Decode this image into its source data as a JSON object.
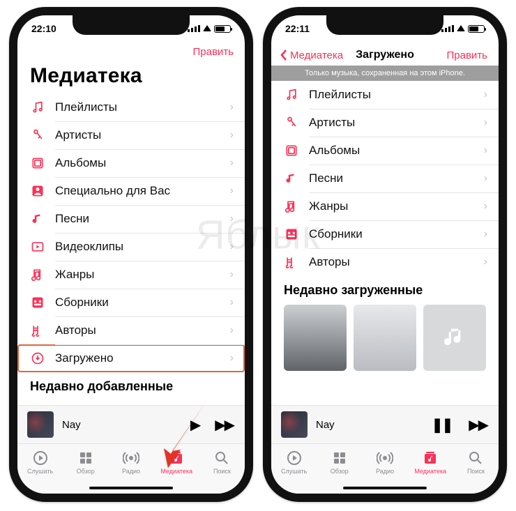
{
  "watermark": "Яблык",
  "left": {
    "status_time": "22:10",
    "edit": "Править",
    "title": "Медиатека",
    "rows": [
      {
        "k": "playlists",
        "label": "Плейлисты"
      },
      {
        "k": "artists",
        "label": "Артисты"
      },
      {
        "k": "albums",
        "label": "Альбомы"
      },
      {
        "k": "foryou",
        "label": "Специально для Вас"
      },
      {
        "k": "songs",
        "label": "Песни"
      },
      {
        "k": "videos",
        "label": "Видеоклипы"
      },
      {
        "k": "genres",
        "label": "Жанры"
      },
      {
        "k": "compilations",
        "label": "Сборники"
      },
      {
        "k": "composers",
        "label": "Авторы"
      },
      {
        "k": "downloaded",
        "label": "Загружено"
      }
    ],
    "recently_added": "Недавно добавленные",
    "now_playing": "Nay",
    "tabs": [
      "Слушать",
      "Обзор",
      "Радио",
      "Медиатека",
      "Поиск"
    ]
  },
  "right": {
    "status_time": "22:11",
    "back": "Медиатека",
    "title": "Загружено",
    "edit": "Править",
    "banner": "Только музыка, сохраненная на этом iPhone.",
    "rows": [
      {
        "k": "playlists",
        "label": "Плейлисты"
      },
      {
        "k": "artists",
        "label": "Артисты"
      },
      {
        "k": "albums",
        "label": "Альбомы"
      },
      {
        "k": "songs",
        "label": "Песни"
      },
      {
        "k": "genres",
        "label": "Жанры"
      },
      {
        "k": "compilations",
        "label": "Сборники"
      },
      {
        "k": "composers",
        "label": "Авторы"
      }
    ],
    "recently_downloaded": "Недавно загруженные",
    "now_playing": "Nay",
    "tabs": [
      "Слушать",
      "Обзор",
      "Радио",
      "Медиатека",
      "Поиск"
    ]
  }
}
